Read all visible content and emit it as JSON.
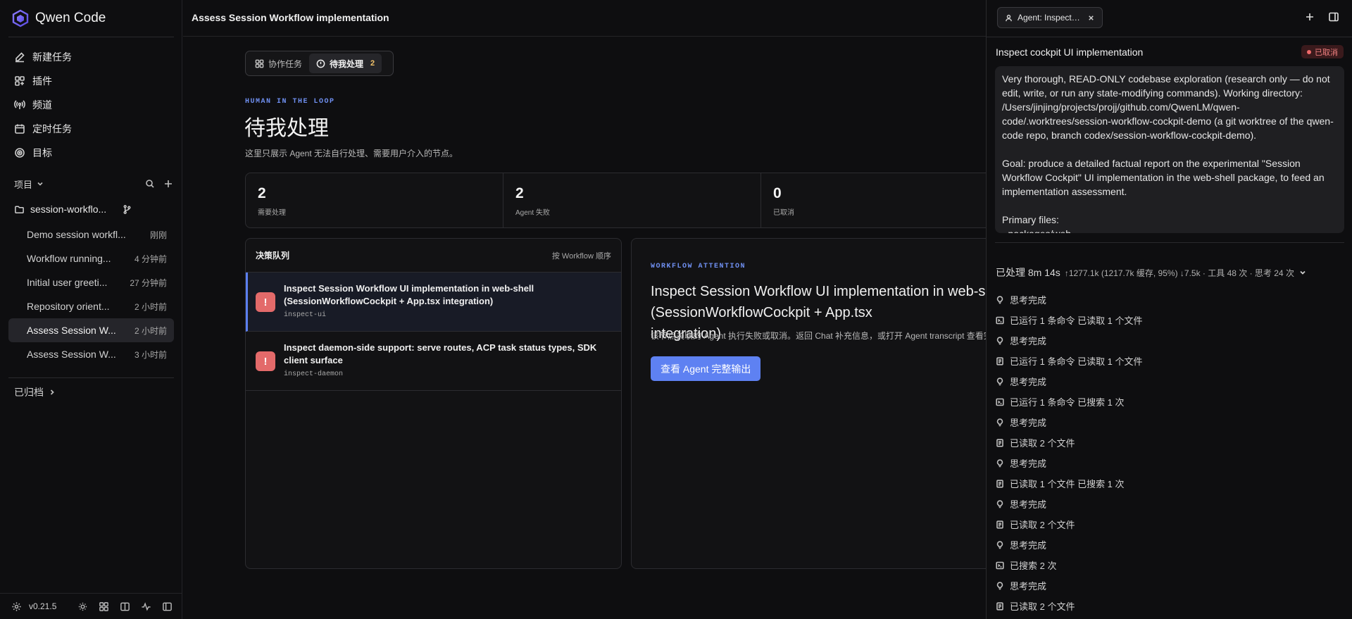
{
  "brand": {
    "name": "Qwen Code",
    "logo": "qwen-logo"
  },
  "sidebar": {
    "nav": [
      {
        "label": "新建任务",
        "icon": "edit-icon"
      },
      {
        "label": "插件",
        "icon": "plugin-icon"
      },
      {
        "label": "频道",
        "icon": "broadcast-icon"
      },
      {
        "label": "定时任务",
        "icon": "calendar-icon"
      },
      {
        "label": "目标",
        "icon": "target-icon"
      }
    ],
    "projects_label": "项目",
    "folder": "session-workflo...",
    "sessions": [
      {
        "title": "Demo session workfl...",
        "time": "刚刚",
        "active": false
      },
      {
        "title": "Workflow running...",
        "time": "4 分钟前",
        "active": false
      },
      {
        "title": "Initial user greeti...",
        "time": "27 分钟前",
        "active": false
      },
      {
        "title": "Repository orient...",
        "time": "2 小时前",
        "active": false
      },
      {
        "title": "Assess Session W...",
        "time": "2 小时前",
        "active": true
      },
      {
        "title": "Assess Session W...",
        "time": "3 小时前",
        "active": false
      }
    ],
    "archived_label": "已归档",
    "version": "v0.21.5"
  },
  "main": {
    "title": "Assess Session Workflow implementation",
    "tabs": [
      {
        "label": "协作任务",
        "icon": "grid-icon",
        "active": false
      },
      {
        "label": "待我处理",
        "icon": "alert-circle-icon",
        "active": true,
        "badge": "2"
      }
    ],
    "eyebrow": "HUMAN IN THE LOOP",
    "heading": "待我处理",
    "description": "这里只展示 Agent 无法自行处理、需要用户介入的节点。",
    "stats": [
      {
        "value": "2",
        "label": "需要处理"
      },
      {
        "value": "2",
        "label": "Agent 失败"
      },
      {
        "value": "0",
        "label": "已取消"
      }
    ],
    "queue": {
      "title": "决策队列",
      "sort": "按 Workflow 顺序",
      "items": [
        {
          "title": "Inspect Session Workflow UI implementation in web-shell (SessionWorkflowCockpit + App.tsx integration)",
          "id": "inspect-ui",
          "active": true
        },
        {
          "title": "Inspect daemon-side support: serve routes, ACP task status types, SDK client surface",
          "id": "inspect-daemon",
          "active": false
        }
      ]
    },
    "detail": {
      "eyebrow": "WORKFLOW ATTENTION",
      "title": "Inspect Session Workflow UI implementation in web-shell (SessionWorkflowCockpit + App.tsx\nintegration)",
      "description": "该节点关联的 Agent 执行失败或取消。返回 Chat 补充信息，或打开 Agent transcript 查看完整输出。",
      "button": "查看 Agent 完整输出"
    }
  },
  "panel": {
    "tab_label": "Agent: Inspect cockpit UI implementation",
    "title": "Inspect cockpit UI implementation",
    "status": "已取消",
    "status_color": "#f06a6a",
    "prompt": "Very thorough, READ-ONLY codebase exploration (research only — do not edit, write, or run any state-modifying commands). Working directory: /Users/jinjing/projects/projj/github.com/QwenLM/qwen-code/.worktrees/session-workflow-cockpit-demo (a git worktree of the qwen-code repo, branch codex/session-workflow-cockpit-demo).\n\nGoal: produce a detailed factual report on the experimental \"Session Workflow Cockpit\" UI implementation in the web-shell package, to feed an implementation assessment.\n\nPrimary files:\n- packages/web",
    "summary_main": "已处理 8m 14s",
    "summary_meta": "↑1277.1k (1217.7k 缓存, 95%) ↓7.5k · 工具 48 次 · 思考 24 次",
    "steps": [
      {
        "icon": "bulb-icon",
        "text": "思考完成"
      },
      {
        "icon": "terminal-icon",
        "text": "已运行 1 条命令 已读取 1 个文件"
      },
      {
        "icon": "bulb-icon",
        "text": "思考完成"
      },
      {
        "icon": "file-icon",
        "text": "已运行 1 条命令 已读取 1 个文件"
      },
      {
        "icon": "bulb-icon",
        "text": "思考完成"
      },
      {
        "icon": "terminal-icon",
        "text": "已运行 1 条命令 已搜索 1 次"
      },
      {
        "icon": "bulb-icon",
        "text": "思考完成"
      },
      {
        "icon": "file-icon",
        "text": "已读取 2 个文件"
      },
      {
        "icon": "bulb-icon",
        "text": "思考完成"
      },
      {
        "icon": "file-icon",
        "text": "已读取 1 个文件 已搜索 1 次"
      },
      {
        "icon": "bulb-icon",
        "text": "思考完成"
      },
      {
        "icon": "file-icon",
        "text": "已读取 2 个文件"
      },
      {
        "icon": "bulb-icon",
        "text": "思考完成"
      },
      {
        "icon": "terminal-icon",
        "text": "已搜索 2 次"
      },
      {
        "icon": "bulb-icon",
        "text": "思考完成"
      },
      {
        "icon": "file-icon",
        "text": "已读取 2 个文件"
      }
    ]
  }
}
